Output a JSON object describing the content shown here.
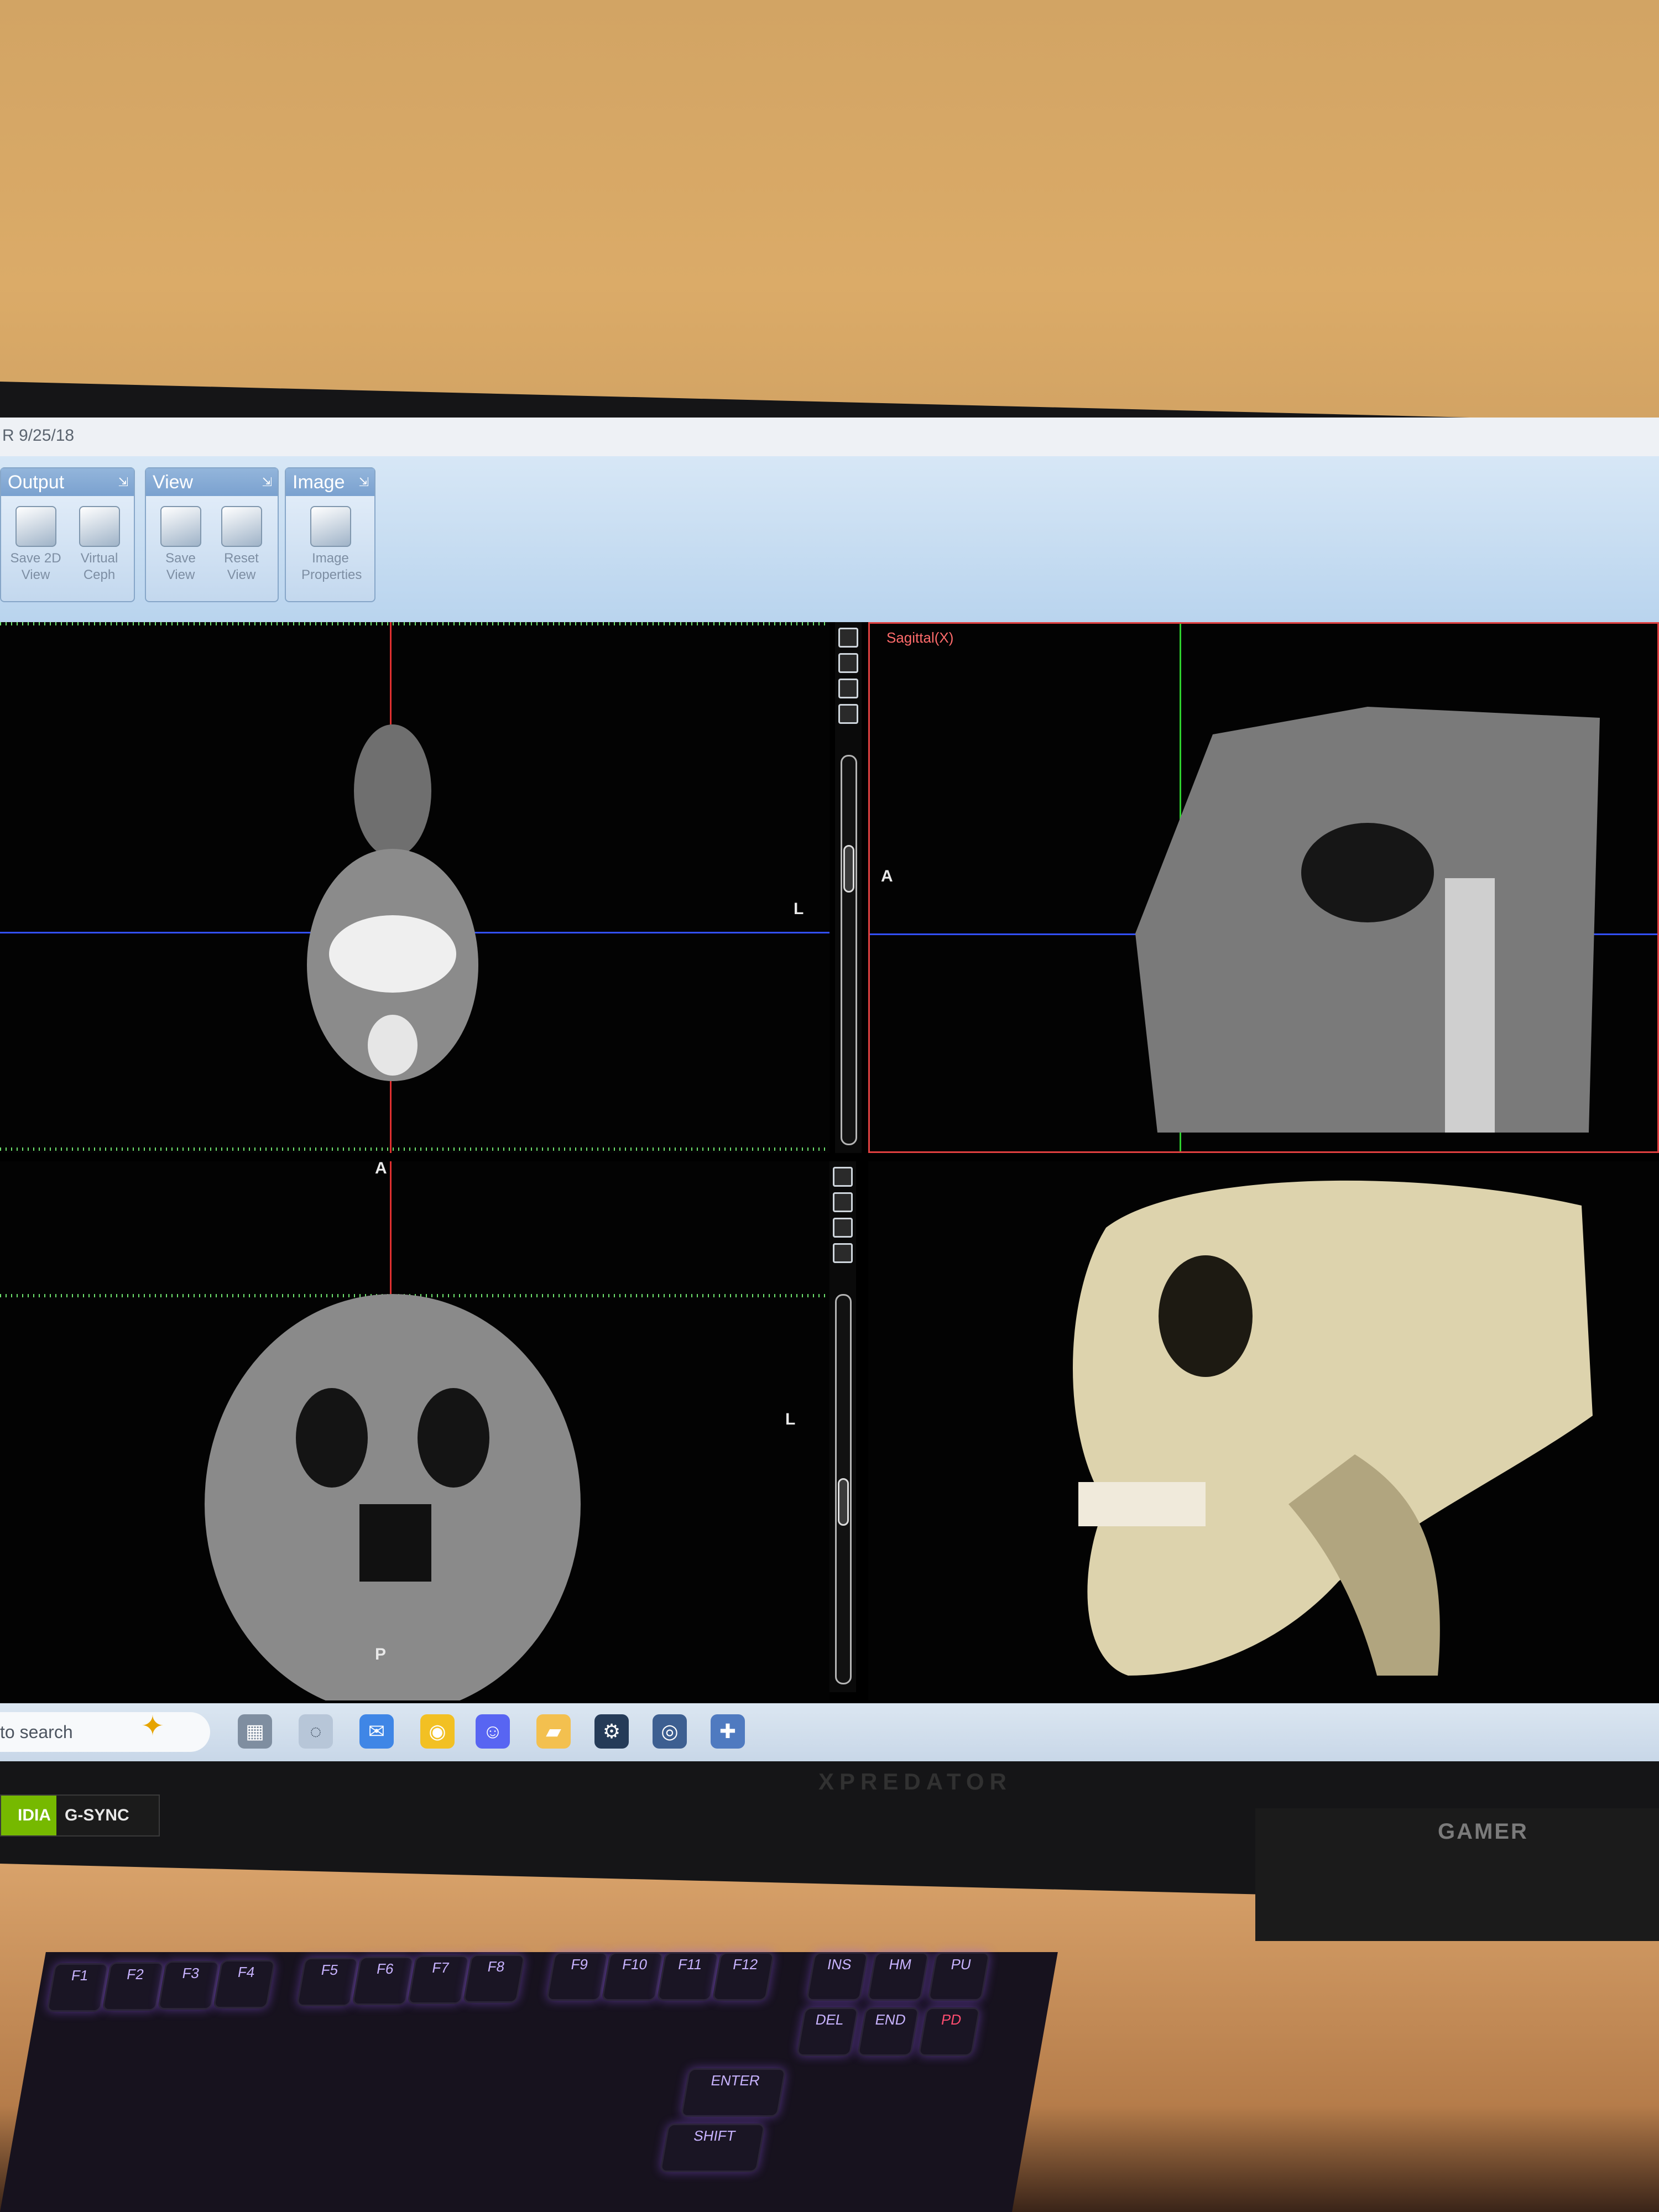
{
  "window": {
    "title": "R 9/25/18"
  },
  "ribbon": {
    "groups": [
      {
        "title": "Output",
        "buttons": [
          "Save 2D View",
          "Virtual Ceph"
        ]
      },
      {
        "title": "View",
        "buttons": [
          "Save View",
          "Reset View"
        ]
      },
      {
        "title": "Image",
        "buttons": [
          "Image Properties"
        ]
      }
    ]
  },
  "viewer": {
    "sagittal_title": "Sagittal(X)",
    "axial_top_right": "L",
    "axial_top_bottom": "A",
    "sagittal_left": "A",
    "axial_bottom_right": "L",
    "axial_bottom_bottom": "P"
  },
  "taskbar": {
    "search_placeholder": "to search",
    "icons": [
      "sparkle-icon",
      "task-view-icon",
      "app-icon",
      "mail-icon",
      "chrome-icon",
      "discord-icon",
      "file-explorer-icon",
      "steam-icon",
      "app-circle-icon",
      "dental-app-icon"
    ]
  },
  "hardware": {
    "nvidia": "IDIA",
    "gsync": "G-SYNC",
    "monitor_brand": "XPREDATOR",
    "stand_brand": "GAMER",
    "keys_row1": [
      "F1",
      "F2",
      "F3",
      "F4",
      "F5",
      "F6",
      "F7",
      "F8",
      "F9",
      "F10",
      "F11",
      "F12"
    ],
    "keys_nav_top": [
      "INS",
      "HM",
      "PU"
    ],
    "keys_nav_bottom": [
      "DEL",
      "END",
      "PD"
    ],
    "key_enter": "ENTER",
    "key_shift": "SHIFT"
  }
}
